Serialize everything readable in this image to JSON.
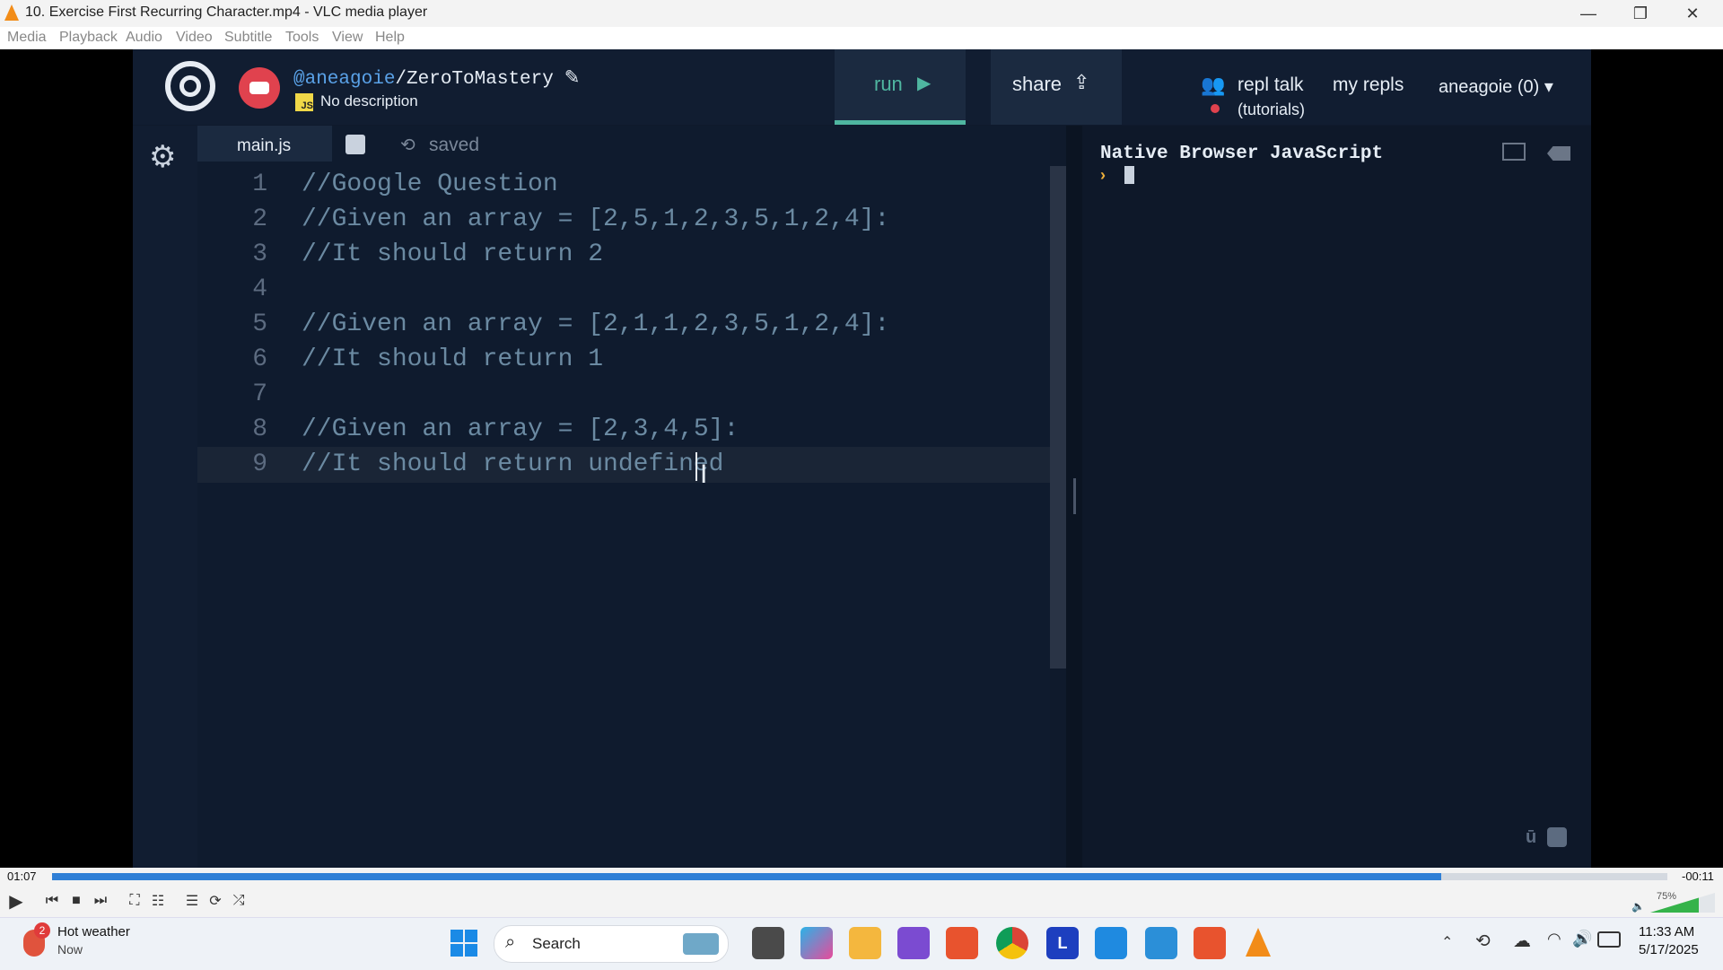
{
  "window": {
    "title": "10. Exercise First Recurring Character.mp4 - VLC media player",
    "minimize_glyph": "—",
    "restore_glyph": "❐",
    "close_glyph": "✕"
  },
  "menu": [
    "Media",
    "Playback",
    "Audio",
    "Video",
    "Subtitle",
    "Tools",
    "View",
    "Help"
  ],
  "repl": {
    "user": "@aneagoie",
    "repo": "/ZeroToMastery",
    "description": "No description",
    "js_badge": "JS",
    "run_label": "run",
    "share_label": "share",
    "repl_talk_label": "repl talk",
    "repl_talk_sub": "(tutorials)",
    "my_repls_label": "my repls",
    "account_label": "aneagoie (0)",
    "file_tab": "main.js",
    "saved_label": "saved",
    "console_title": "Native Browser JavaScript",
    "prompt_glyph": "›"
  },
  "code_lines": [
    {
      "num": "1",
      "text": "//Google Question"
    },
    {
      "num": "2",
      "text": "//Given an array = [2,5,1,2,3,5,1,2,4]:"
    },
    {
      "num": "3",
      "text": "//It should return 2"
    },
    {
      "num": "4",
      "text": ""
    },
    {
      "num": "5",
      "text": "//Given an array = [2,1,1,2,3,5,1,2,4]:"
    },
    {
      "num": "6",
      "text": "//It should return 1"
    },
    {
      "num": "7",
      "text": ""
    },
    {
      "num": "8",
      "text": "//Given an array = [2,3,4,5]:"
    },
    {
      "num": "9",
      "text": "//It should return undefined"
    }
  ],
  "player": {
    "elapsed": "01:07",
    "remaining": "-00:11",
    "progress": 0.86,
    "volume": "75%",
    "volume_level": 0.75
  },
  "taskbar": {
    "weather_title": "Hot weather",
    "weather_sub": "Now",
    "weather_badge": "2",
    "search_label": "Search",
    "time": "11:33 AM",
    "date": "5/17/2025",
    "apps": [
      "windows-start",
      "search",
      "task-view",
      "m365",
      "file-explorer",
      "visual-studio",
      "brave",
      "chrome",
      "l-app",
      "vscode",
      "notepad",
      "brave-alt",
      "vlc"
    ]
  },
  "colors": {
    "repl_bg": "#0f1a2c",
    "accent_green": "#4fb6a0",
    "vlc_orange": "#f28c18",
    "progress_blue": "#2f7fd6"
  }
}
